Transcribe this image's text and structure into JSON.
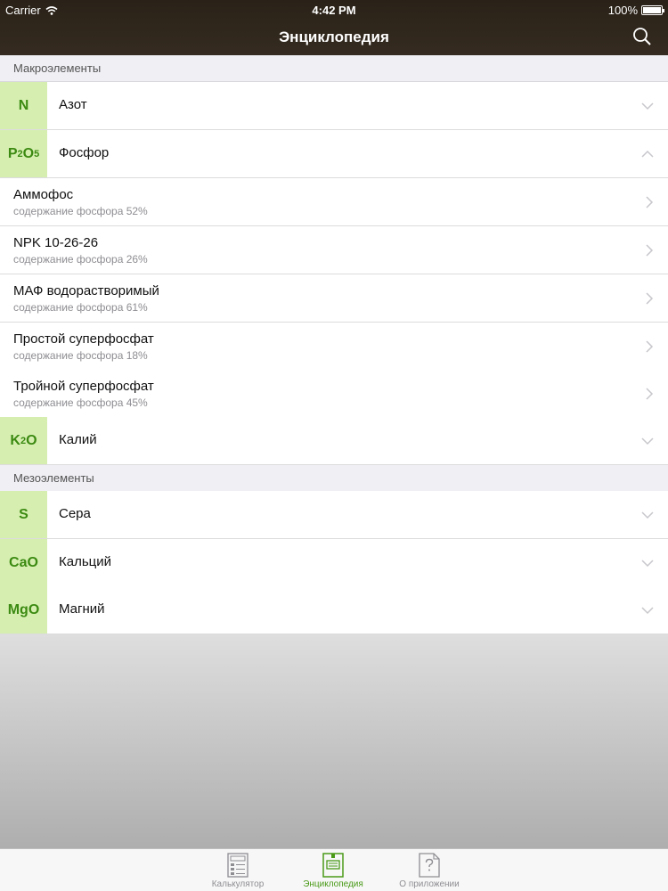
{
  "status": {
    "carrier": "Carrier",
    "time": "4:42 PM",
    "battery": "100%"
  },
  "nav": {
    "title": "Энциклопедия"
  },
  "sections": {
    "macro": "Макроэлементы",
    "meso": "Мезоэлементы"
  },
  "elements": {
    "n": {
      "badge": "N",
      "label": "Азот"
    },
    "p": {
      "badge_main": "P",
      "badge_sub1": "2",
      "badge_mid": "O",
      "badge_sub2": "5",
      "label": "Фосфор"
    },
    "k": {
      "badge_main": "K",
      "badge_sub1": "2",
      "badge_mid": "O",
      "label": "Калий"
    },
    "s": {
      "badge": "S",
      "label": "Сера"
    },
    "ca": {
      "badge": "CaO",
      "label": "Кальций"
    },
    "mg": {
      "badge": "MgO",
      "label": "Магний"
    }
  },
  "phosphorus_items": [
    {
      "title": "Аммофос",
      "subtitle": "содержание фосфора 52%"
    },
    {
      "title": "NPK 10-26-26",
      "subtitle": "содержание фосфора 26%"
    },
    {
      "title": "МАФ водорастворимый",
      "subtitle": "содержание фосфора 61%"
    },
    {
      "title": "Простой суперфосфат",
      "subtitle": "содержание фосфора 18%"
    },
    {
      "title": "Тройной суперфосфат",
      "subtitle": "содержание фосфора 45%"
    }
  ],
  "tabs": [
    {
      "label": "Калькулятор",
      "icon": "calculator-icon"
    },
    {
      "label": "Энциклопедия",
      "icon": "encyclopedia-icon"
    },
    {
      "label": "О приложении",
      "icon": "about-icon"
    }
  ],
  "colors": {
    "accent": "#4a9a18",
    "badge_bg": "#d6efb1",
    "badge_text": "#3c8a12",
    "navbar": "#2f271c"
  }
}
